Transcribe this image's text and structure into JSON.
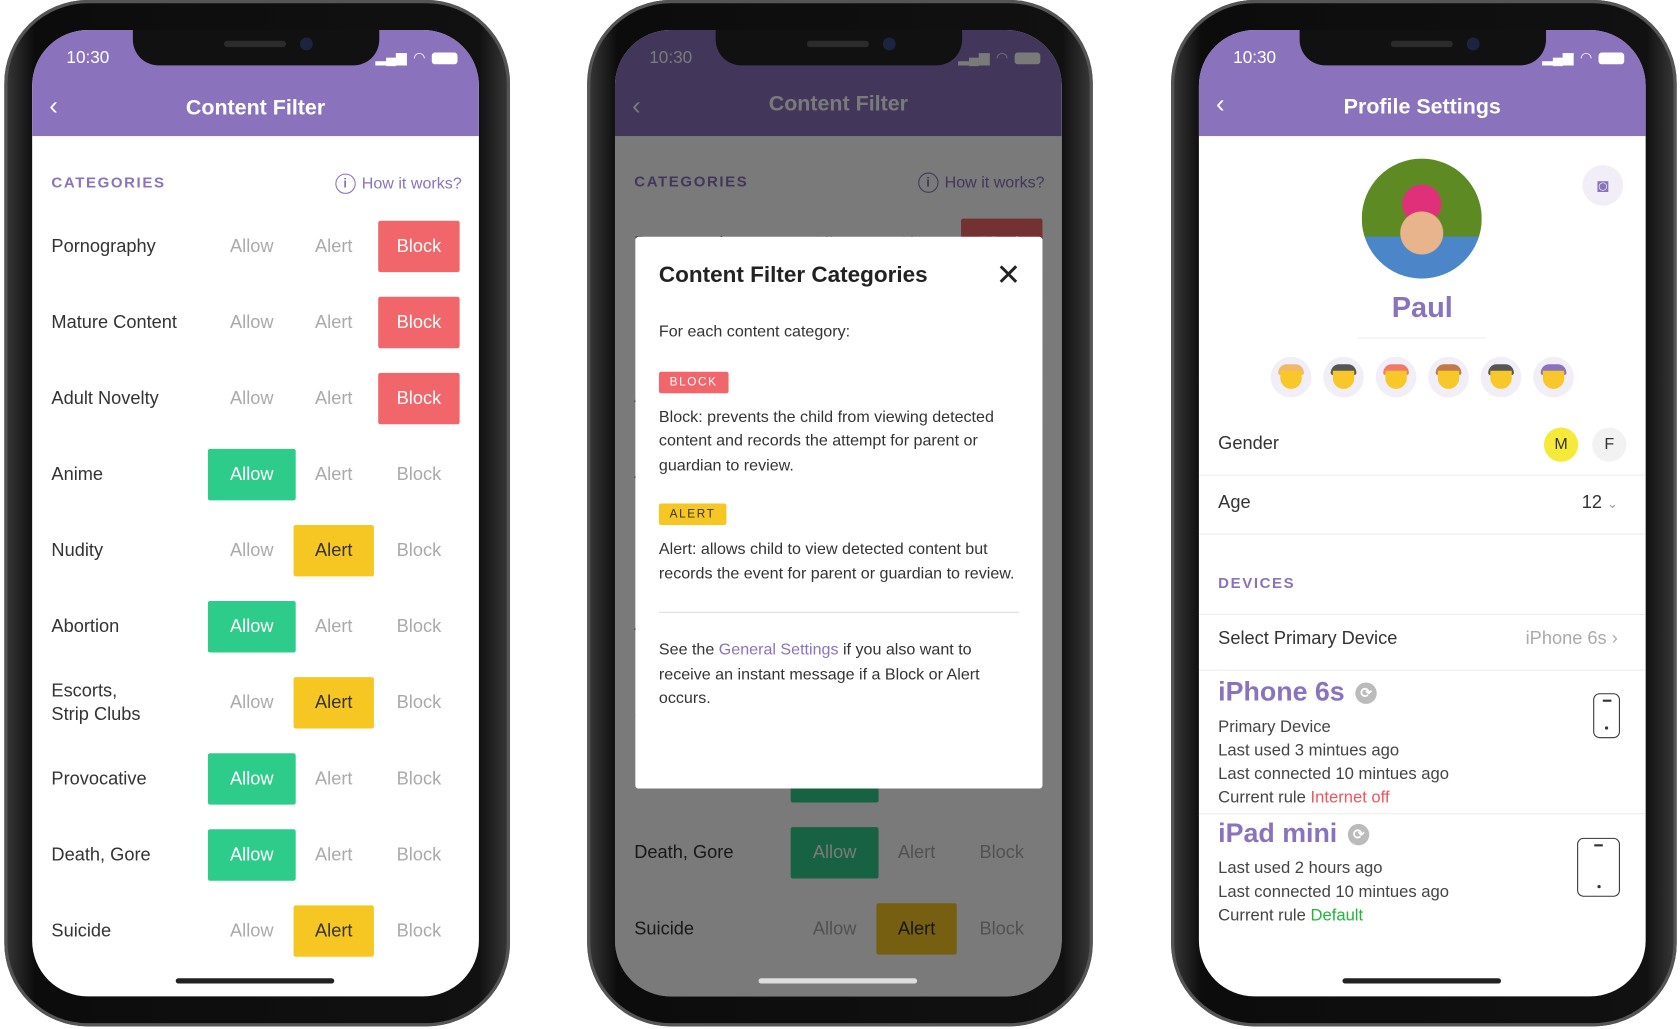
{
  "status_bar": {
    "time": "10:30"
  },
  "content_filter": {
    "title": "Content Filter",
    "section_label": "CATEGORIES",
    "how_it_works": "How it works?",
    "options": [
      "Allow",
      "Alert",
      "Block"
    ],
    "categories": [
      {
        "name": "Pornography",
        "selected": "Block"
      },
      {
        "name": "Mature Content",
        "selected": "Block"
      },
      {
        "name": "Adult Novelty",
        "selected": "Block"
      },
      {
        "name": "Anime",
        "selected": "Allow"
      },
      {
        "name": "Nudity",
        "selected": "Alert"
      },
      {
        "name": "Abortion",
        "selected": "Allow"
      },
      {
        "name": "Escorts,\nStrip Clubs",
        "selected": "Alert"
      },
      {
        "name": "Provocative",
        "selected": "Allow"
      },
      {
        "name": "Death, Gore",
        "selected": "Allow"
      },
      {
        "name": "Suicide",
        "selected": "Alert"
      }
    ]
  },
  "modal": {
    "title": "Content Filter Categories",
    "intro": "For each content category:",
    "block_tag": "BLOCK",
    "block_text": "Block: prevents the child from viewing detected content and records the attempt for parent or guardian to review.",
    "alert_tag": "ALERT",
    "alert_text": "Alert: allows child to view detected content but records the event for parent or guardian to review.",
    "footer_pre": "See the ",
    "footer_link": "General Settings",
    "footer_post": " if you also want to receive an instant message if a Block or Alert occurs."
  },
  "profile": {
    "title": "Profile Settings",
    "name": "Paul",
    "gender_label": "Gender",
    "gender_options": [
      "M",
      "F"
    ],
    "gender_selected": "M",
    "age_label": "Age",
    "age_value": "12",
    "devices_label": "DEVICES",
    "primary_label": "Select Primary Device",
    "primary_value": "iPhone 6s",
    "rule_prefix": "Current rule",
    "devices": [
      {
        "name": "iPhone 6s",
        "lines": [
          "Primary Device",
          "Last used 3 mintues ago",
          "Last connected 10 mintues ago"
        ],
        "rule": "Internet off",
        "rule_color": "#f0555a",
        "type": "phone"
      },
      {
        "name": "iPad mini",
        "lines": [
          "Last used 2 hours ago",
          "Last connected 10 mintues ago"
        ],
        "rule": "Default",
        "rule_color": "#22b33a",
        "type": "tablet"
      }
    ]
  },
  "colors": {
    "brand": "#8a72bd",
    "allow": "#2ecc8a",
    "alert": "#f6c623",
    "block": "#f0666a"
  }
}
